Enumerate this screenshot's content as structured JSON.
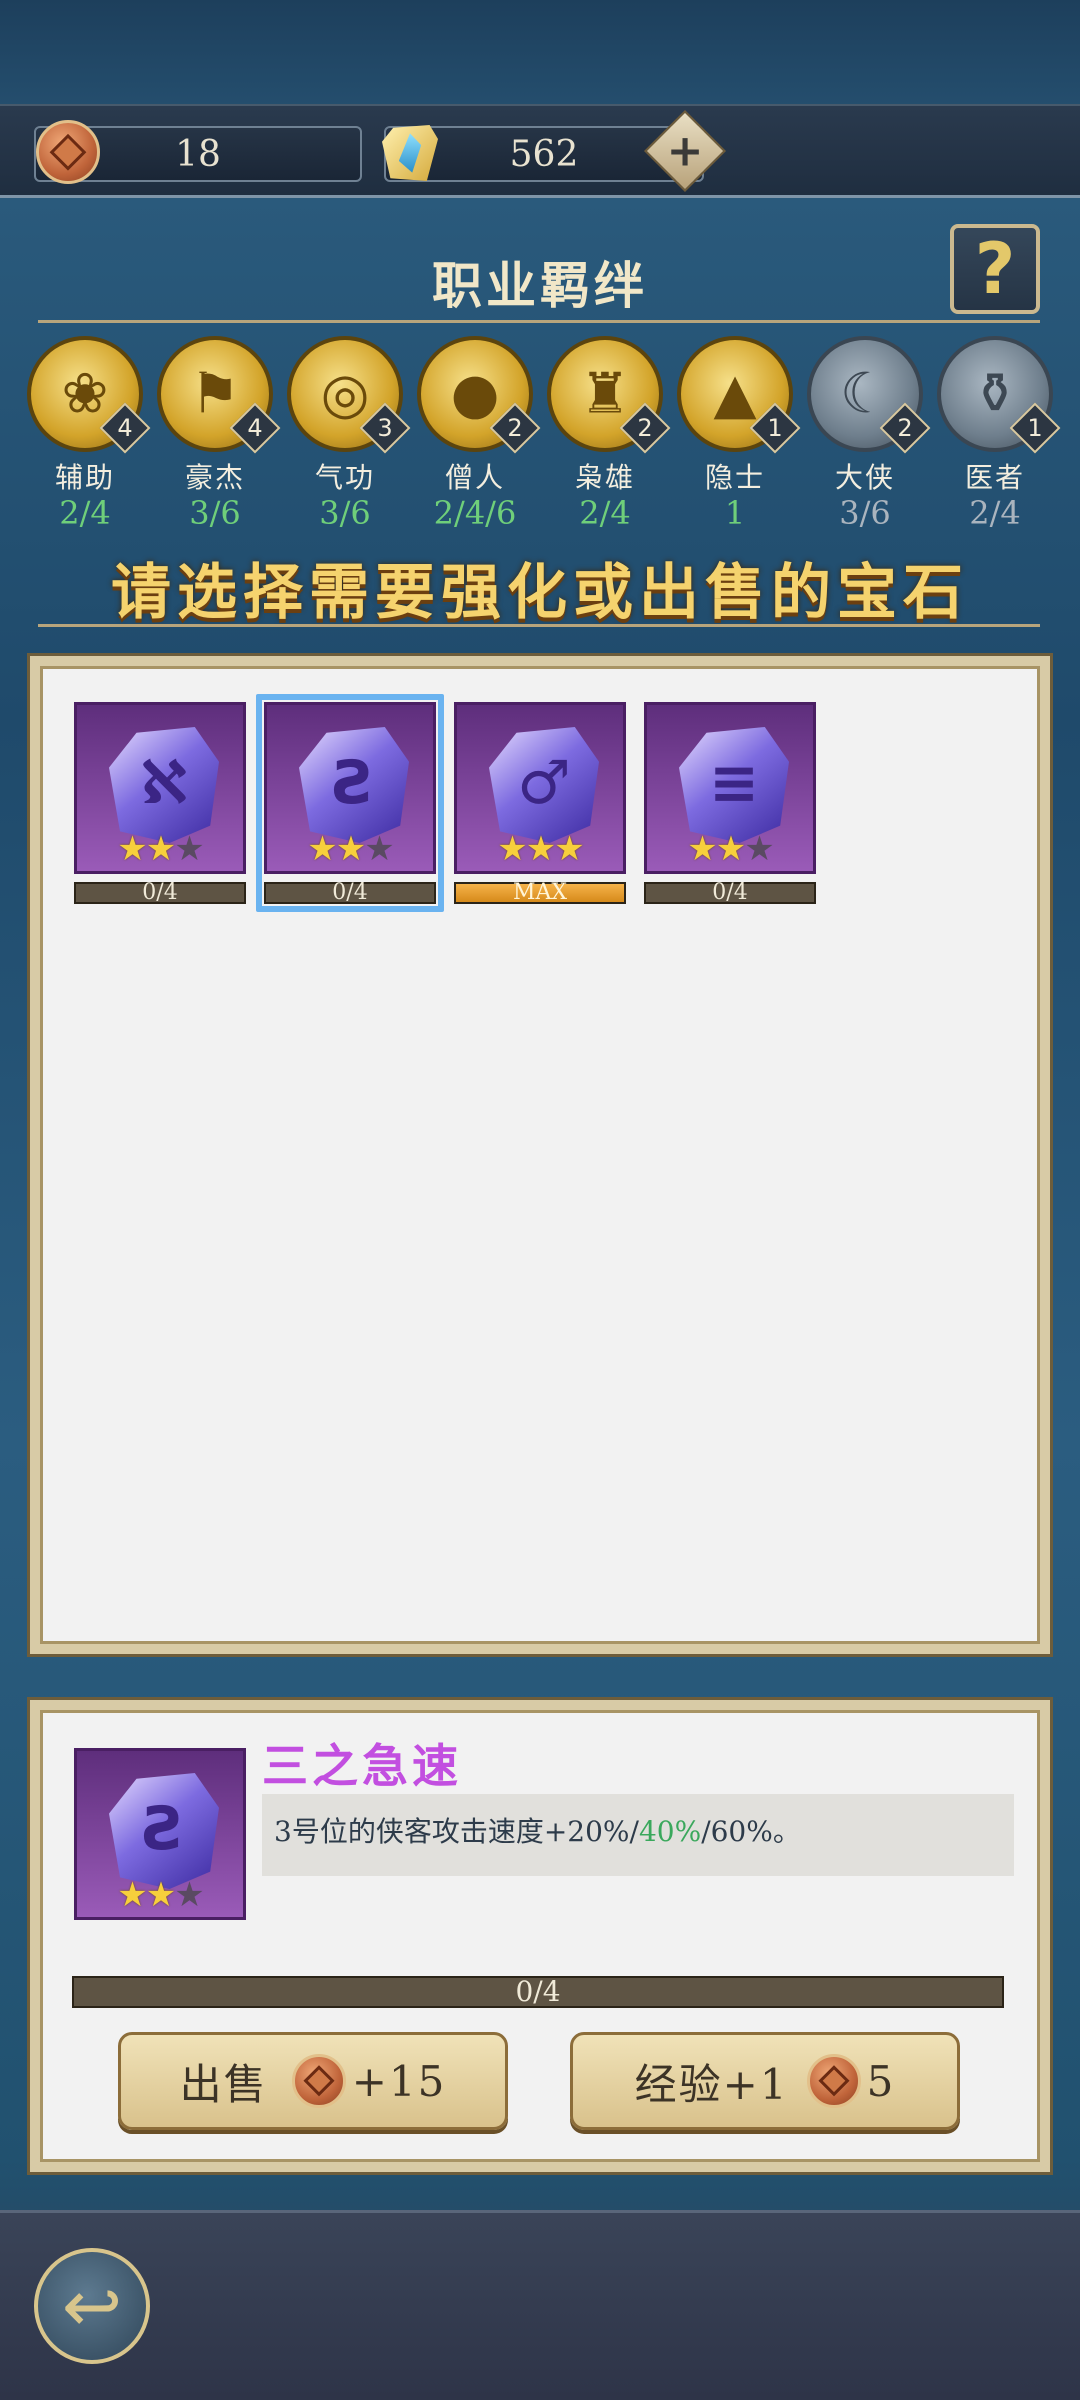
{
  "resources": {
    "coins": "18",
    "gems": "562",
    "coin_icon": "copper-coin-icon",
    "gem_icon": "crystal-gem-icon",
    "add_icon": "plus-icon"
  },
  "bond_panel": {
    "title": "职业羁绊",
    "help_label": "?",
    "bonds": [
      {
        "name": "辅助",
        "count": "4",
        "progress": "2/4",
        "active": true,
        "icon": "lotus-icon",
        "glyph": "❀"
      },
      {
        "name": "豪杰",
        "count": "4",
        "progress": "3/6",
        "active": true,
        "icon": "banner-icon",
        "glyph": "⚑"
      },
      {
        "name": "气功",
        "count": "3",
        "progress": "3/6",
        "active": true,
        "icon": "swirl-icon",
        "glyph": "◎"
      },
      {
        "name": "僧人",
        "count": "2",
        "progress": "2/4/6",
        "active": true,
        "icon": "prayer-beads-icon",
        "glyph": "●"
      },
      {
        "name": "枭雄",
        "count": "2",
        "progress": "2/4",
        "active": true,
        "icon": "helmet-icon",
        "glyph": "♜"
      },
      {
        "name": "隐士",
        "count": "1",
        "progress": "1",
        "active": true,
        "icon": "hermit-hat-icon",
        "glyph": "▲"
      },
      {
        "name": "大侠",
        "count": "2",
        "progress": "3/6",
        "active": false,
        "icon": "sword-arc-icon",
        "glyph": "☾"
      },
      {
        "name": "医者",
        "count": "1",
        "progress": "2/4",
        "active": false,
        "icon": "gourd-icon",
        "glyph": "⚱"
      }
    ]
  },
  "instruction": "请选择需要强化或出售的宝石",
  "gems": [
    {
      "glyph": "ℵ",
      "stars": 2,
      "max_stars": 3,
      "progress": "0/4",
      "max": false,
      "selected": false
    },
    {
      "glyph": "Ƨ",
      "stars": 2,
      "max_stars": 3,
      "progress": "0/4",
      "max": false,
      "selected": true
    },
    {
      "glyph": "♂",
      "stars": 3,
      "max_stars": 3,
      "progress": "MAX",
      "max": true,
      "selected": false
    },
    {
      "glyph": "≡",
      "stars": 2,
      "max_stars": 3,
      "progress": "0/4",
      "max": false,
      "selected": false
    }
  ],
  "detail": {
    "name": "三之急速",
    "desc_prefix": "3号位的侠客攻击速度+20%/",
    "desc_highlight": "40%",
    "desc_suffix": "/60%。",
    "glyph": "Ƨ",
    "stars": 2,
    "progress": "0/4",
    "sell_label": "出售",
    "sell_value": "+15",
    "exp_label": "经验+1",
    "exp_cost": "5",
    "highlight_color": "#3aa85c"
  },
  "back_icon": "back-arrow-icon"
}
